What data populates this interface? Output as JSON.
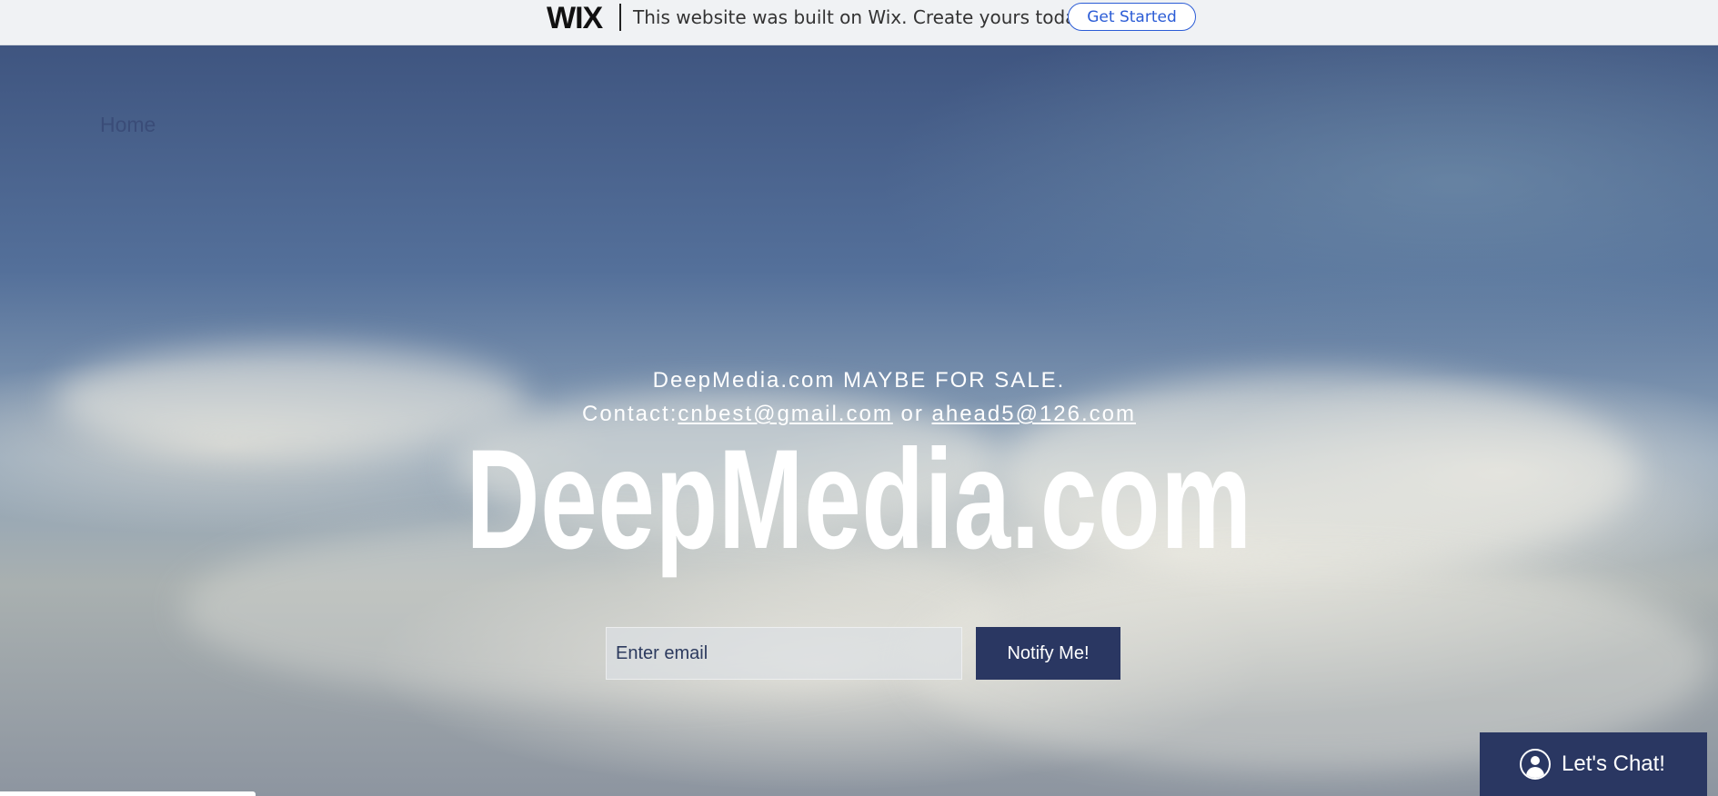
{
  "wix_banner": {
    "logo": "WIX",
    "message": "This website was built on Wix. Create yours today.",
    "cta_label": "Get Started"
  },
  "nav": {
    "items": [
      {
        "label": "Home"
      }
    ]
  },
  "hero": {
    "sale_text": "DeepMedia.com MAYBE FOR SALE.",
    "contact_prefix": "Contact:",
    "contact_email_1": "cnbest@gmail.com",
    "contact_separator": " or ",
    "contact_email_2": "ahead5@126.com",
    "title": "DeepMedia.com"
  },
  "signup": {
    "email_placeholder": "Enter email",
    "email_value": "",
    "submit_label": "Notify Me!"
  },
  "chat": {
    "label": "Let's Chat!",
    "icon": "user-icon"
  },
  "colors": {
    "accent_dark": "#2a3762",
    "wix_blue": "#2b5cd6",
    "banner_bg": "#f0f2f4"
  }
}
